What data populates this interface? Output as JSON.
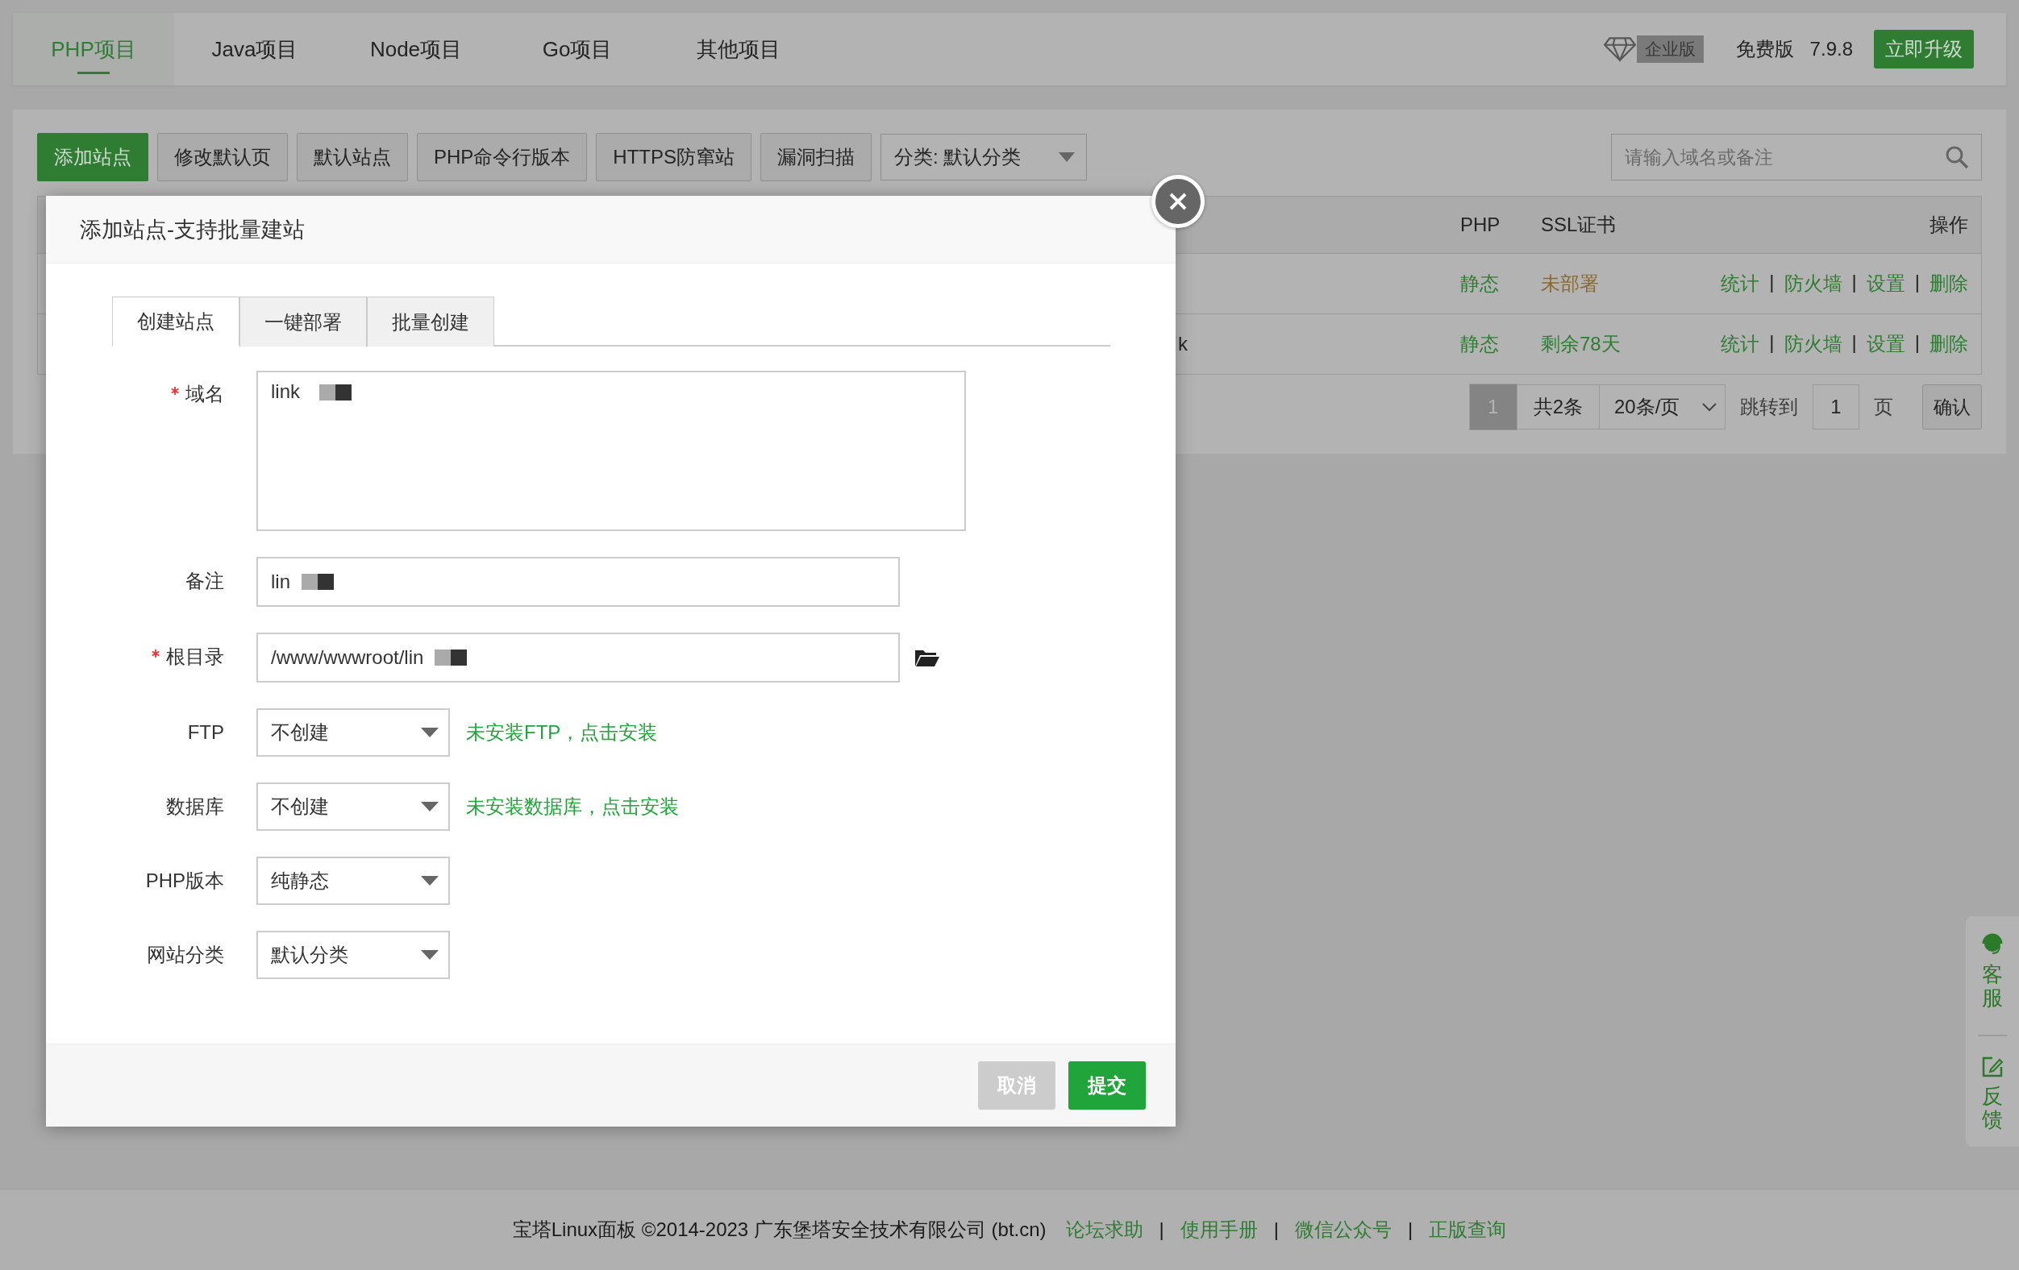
{
  "top_tabs": [
    {
      "label": "PHP项目",
      "selected": true
    },
    {
      "label": "Java项目",
      "selected": false
    },
    {
      "label": "Node项目",
      "selected": false
    },
    {
      "label": "Go项目",
      "selected": false
    },
    {
      "label": "其他项目",
      "selected": false
    }
  ],
  "edition": {
    "badge": "企业版",
    "plan": "免费版",
    "version": "7.9.8",
    "upgrade": "立即升级"
  },
  "toolbar": {
    "buttons": [
      {
        "label": "添加站点",
        "kind": "primary"
      },
      {
        "label": "修改默认页",
        "kind": "default"
      },
      {
        "label": "默认站点",
        "kind": "default"
      },
      {
        "label": "PHP命令行版本",
        "kind": "default"
      },
      {
        "label": "HTTPS防窜站",
        "kind": "default"
      },
      {
        "label": "漏洞扫描",
        "kind": "default"
      }
    ],
    "category": "分类: 默认分类",
    "search": {
      "placeholder": "请输入域名或备注"
    }
  },
  "table": {
    "columns": [
      "PHP",
      "SSL证书",
      "操作"
    ],
    "separator": "|",
    "rows": [
      {
        "php": "静态",
        "ssl": "未部署",
        "color": "#8a6a2e",
        "actions": [
          "统计",
          "防火墙",
          "设置",
          "删除"
        ]
      },
      {
        "column_1": "k",
        "php": "静态",
        "ssl": "剩余78天",
        "color": "#2e7d32",
        "actions": [
          "统计",
          "防火墙",
          "设置",
          "删除"
        ]
      }
    ]
  },
  "pagination": {
    "pages": [
      {
        "label": "1",
        "selected": true
      }
    ],
    "total": "共2条",
    "per_page": "20条/页",
    "jump_label": "跳转到",
    "jump_value": "1",
    "page_unit": "页",
    "confirm": "确认"
  },
  "dialog": {
    "title": "添加站点-支持批量建站",
    "tabs": [
      {
        "label": "创建站点",
        "selected": true
      },
      {
        "label": "一键部署",
        "selected": false
      },
      {
        "label": "批量创建",
        "selected": false
      }
    ],
    "fields": [
      {
        "kind": "textarea",
        "label": "域名",
        "required": true,
        "value": "link",
        "redacted": true
      },
      {
        "kind": "input",
        "label": "备注",
        "required": false,
        "value": "lin",
        "redacted": true
      },
      {
        "kind": "input",
        "label": "根目录",
        "required": true,
        "value": "/www/wwwroot/lin",
        "redacted": true,
        "browse": true
      },
      {
        "kind": "select",
        "label": "FTP",
        "required": false,
        "value": "不创建",
        "hint": "未安装FTP，点击安装"
      },
      {
        "kind": "select",
        "label": "数据库",
        "required": false,
        "value": "不创建",
        "hint": "未安装数据库，点击安装"
      },
      {
        "kind": "select",
        "label": "PHP版本",
        "required": false,
        "value": "纯静态"
      },
      {
        "kind": "select",
        "label": "网站分类",
        "required": false,
        "value": "默认分类"
      }
    ],
    "buttons": [
      {
        "label": "取消",
        "kind": "secondary"
      },
      {
        "label": "提交",
        "kind": "primary"
      }
    ]
  },
  "side_widget": [
    {
      "label": "客服",
      "kind": "support"
    },
    {
      "label": "反馈",
      "kind": "feedback"
    }
  ],
  "footer": {
    "copyright": "宝塔Linux面板 ©2014-2023 广东堡塔安全技术有限公司 (bt.cn)",
    "separator": "|",
    "links": [
      "论坛求助",
      "使用手册",
      "微信公众号",
      "正版查询"
    ]
  }
}
